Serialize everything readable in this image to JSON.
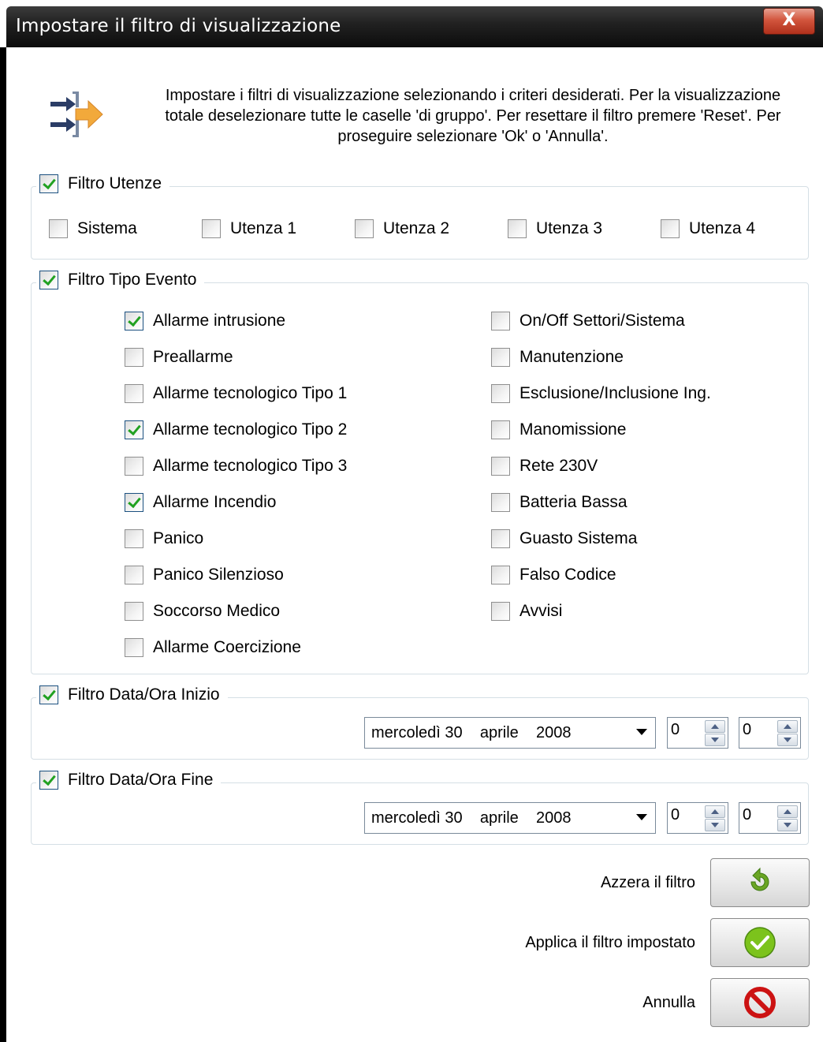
{
  "window": {
    "title": "Impostare il filtro di visualizzazione",
    "close_label": "X"
  },
  "intro": {
    "icon": "filter-arrows-icon",
    "line1": "Impostare i filtri di visualizzazione selezionando i criteri desiderati. Per la visualizzazione",
    "line2": "totale deselezionare tutte le caselle 'di gruppo'. Per resettare il filtro premere 'Reset'. Per",
    "line3": "proseguire selezionare 'Ok' o 'Annulla'."
  },
  "filtro_utenze": {
    "label": "Filtro Utenze",
    "checked": true,
    "items": [
      {
        "label": "Sistema",
        "checked": false
      },
      {
        "label": "Utenza 1",
        "checked": false
      },
      {
        "label": "Utenza 2",
        "checked": false
      },
      {
        "label": "Utenza 3",
        "checked": false
      },
      {
        "label": "Utenza 4",
        "checked": false
      }
    ]
  },
  "filtro_tipo_evento": {
    "label": "Filtro Tipo Evento",
    "checked": true,
    "left": [
      {
        "label": "Allarme intrusione",
        "checked": true
      },
      {
        "label": "Preallarme",
        "checked": false
      },
      {
        "label": "Allarme tecnologico Tipo 1",
        "checked": false
      },
      {
        "label": "Allarme tecnologico Tipo 2",
        "checked": true
      },
      {
        "label": "Allarme tecnologico Tipo 3",
        "checked": false
      },
      {
        "label": "Allarme Incendio",
        "checked": true
      },
      {
        "label": "Panico",
        "checked": false
      },
      {
        "label": "Panico Silenzioso",
        "checked": false
      },
      {
        "label": "Soccorso Medico",
        "checked": false
      },
      {
        "label": "Allarme Coercizione",
        "checked": false
      }
    ],
    "right": [
      {
        "label": "On/Off Settori/Sistema",
        "checked": false
      },
      {
        "label": "Manutenzione",
        "checked": false
      },
      {
        "label": "Esclusione/Inclusione Ing.",
        "checked": false
      },
      {
        "label": "Manomissione",
        "checked": false
      },
      {
        "label": "Rete 230V",
        "checked": false
      },
      {
        "label": "Batteria Bassa",
        "checked": false
      },
      {
        "label": "Guasto Sistema",
        "checked": false
      },
      {
        "label": "Falso Codice",
        "checked": false
      },
      {
        "label": "Avvisi",
        "checked": false
      }
    ]
  },
  "filtro_inizio": {
    "label": "Filtro Data/Ora Inizio",
    "checked": true,
    "date": "mercoledì 30    aprile    2008",
    "hour": "0",
    "minute": "0"
  },
  "filtro_fine": {
    "label": "Filtro Data/Ora Fine",
    "checked": true,
    "date": "mercoledì 30    aprile    2008",
    "hour": "0",
    "minute": "0"
  },
  "actions": {
    "reset_label": "Azzera il filtro",
    "apply_label": "Applica il filtro impostato",
    "cancel_label": "Annulla"
  },
  "colors": {
    "titlebar": "#1a1a1a",
    "close": "#c8452f",
    "check": "#21a121",
    "group_border": "#d5dfe5"
  }
}
